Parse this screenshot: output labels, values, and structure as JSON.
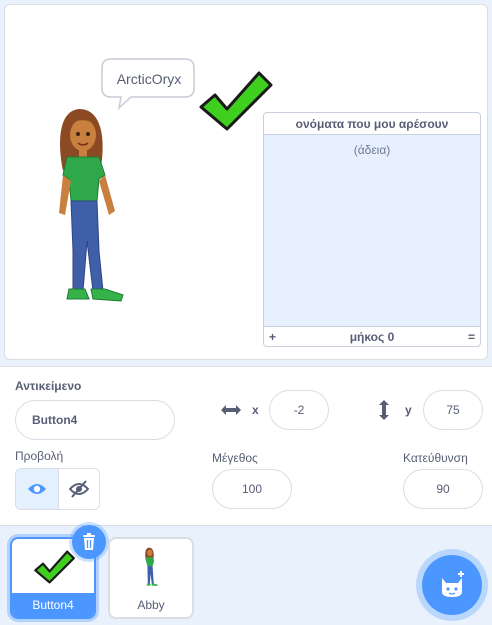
{
  "stage": {
    "speech_text": "ArcticOryx",
    "list_monitor": {
      "title": "ονόματα που μου αρέσουν",
      "empty_text": "(άδεια)",
      "add_label": "+",
      "length_label": "μήκος 0",
      "resize_label": "="
    }
  },
  "sprite_info": {
    "sprite_label": "Αντικείμενο",
    "sprite_name": "Button4",
    "x_label": "x",
    "x_value": "-2",
    "y_label": "y",
    "y_value": "75",
    "show_label": "Προβολή",
    "size_label": "Μέγεθος",
    "size_value": "100",
    "direction_label": "Κατεύθυνση",
    "direction_value": "90"
  },
  "sprites": [
    {
      "name": "Button4",
      "selected": true
    },
    {
      "name": "Abby",
      "selected": false
    }
  ],
  "colors": {
    "accent": "#4c97ff",
    "check_green": "#3ecf1f",
    "text": "#575e75"
  },
  "icons": {
    "delete": "trash-icon",
    "add_sprite": "cat-plus-icon",
    "x_axis": "horizontal-arrows-icon",
    "y_axis": "vertical-arrows-icon",
    "show": "eye-icon",
    "hide": "eye-slash-icon"
  }
}
